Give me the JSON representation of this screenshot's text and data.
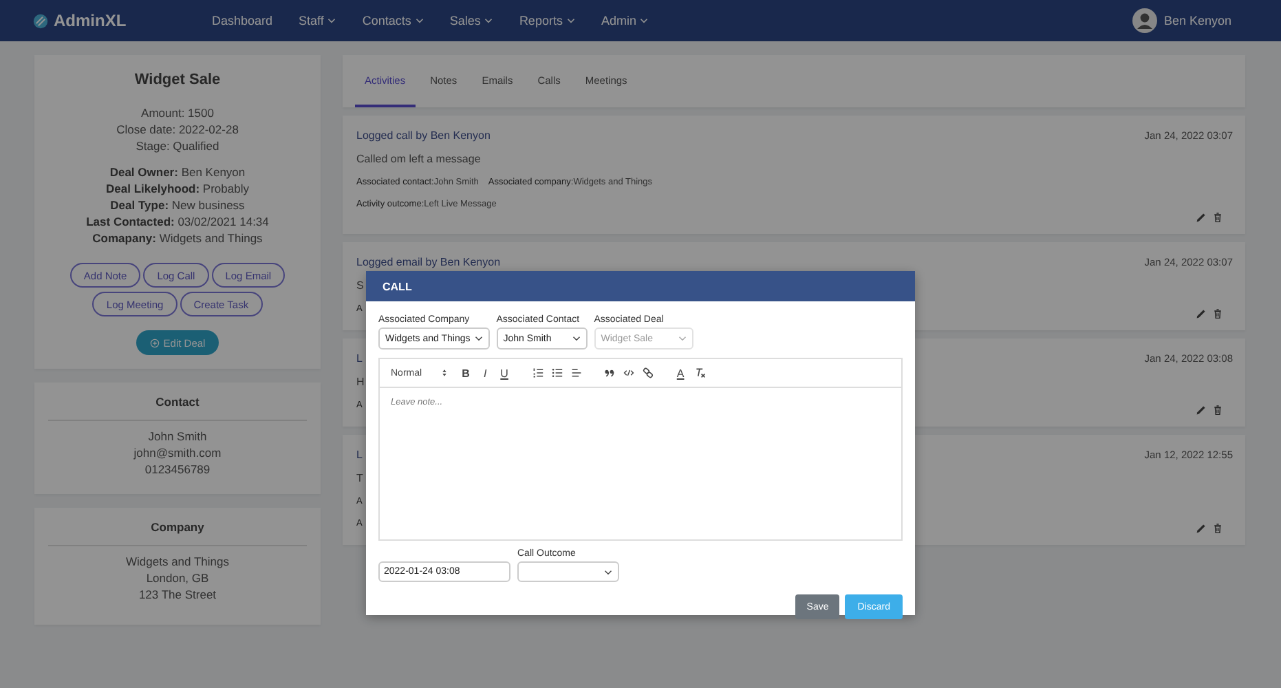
{
  "navbar": {
    "brand": "AdminXL",
    "menu": [
      {
        "label": "Dashboard",
        "dropdown": false
      },
      {
        "label": "Staff",
        "dropdown": true
      },
      {
        "label": "Contacts",
        "dropdown": true
      },
      {
        "label": "Sales",
        "dropdown": true
      },
      {
        "label": "Reports",
        "dropdown": true
      },
      {
        "label": "Admin",
        "dropdown": true
      }
    ],
    "user": "Ben Kenyon"
  },
  "deal": {
    "title": "Widget Sale",
    "summary": [
      "Amount: 1500",
      "Close date: 2022-02-28",
      "Stage: Qualified"
    ],
    "details": [
      {
        "label": "Deal Owner:",
        "value": "Ben Kenyon"
      },
      {
        "label": "Deal Likelyhood:",
        "value": "Probably"
      },
      {
        "label": "Deal Type:",
        "value": "New business"
      },
      {
        "label": "Last Contacted:",
        "value": "03/02/2021 14:34"
      },
      {
        "label": "Comapany:",
        "value": "Widgets and Things"
      }
    ],
    "actions": [
      "Add Note",
      "Log Call",
      "Log Email",
      "Log Meeting",
      "Create Task"
    ],
    "edit_button": "Edit Deal"
  },
  "contact": {
    "title": "Contact",
    "lines": [
      "John Smith",
      "john@smith.com",
      "0123456789"
    ]
  },
  "company": {
    "title": "Company",
    "lines": [
      "Widgets and Things",
      "London, GB",
      "123 The Street"
    ]
  },
  "tabs": [
    {
      "label": "Activities",
      "selected": true
    },
    {
      "label": "Notes",
      "selected": false
    },
    {
      "label": "Emails",
      "selected": false
    },
    {
      "label": "Calls",
      "selected": false
    },
    {
      "label": "Meetings",
      "selected": false
    }
  ],
  "activities": [
    {
      "title": "Logged call by Ben Kenyon",
      "date": "Jan 24, 2022 03:07",
      "lines": [
        {
          "kind": "body",
          "text": "Called om left a message"
        },
        {
          "kind": "meta",
          "items": [
            {
              "label": "Associated contact:",
              "value": "John Smith"
            },
            {
              "label": "Associated company:",
              "value": "Widgets and Things"
            }
          ]
        },
        {
          "kind": "meta",
          "items": [
            {
              "label": "Activity outcome:",
              "value": "Left Live Message"
            }
          ]
        }
      ]
    },
    {
      "title": "Logged email by Ben Kenyon",
      "date": "Jan 24, 2022 03:07",
      "lines": [
        {
          "kind": "body",
          "text": "S"
        },
        {
          "kind": "meta",
          "items": [
            {
              "label": "A",
              "value": ""
            }
          ]
        }
      ]
    },
    {
      "title": "L",
      "date": "Jan 24, 2022 03:08",
      "lines": [
        {
          "kind": "body",
          "text": "H"
        },
        {
          "kind": "meta",
          "items": [
            {
              "label": "A",
              "value": ""
            }
          ]
        }
      ]
    },
    {
      "title": "L",
      "date": "Jan 12, 2022 12:55",
      "lines": [
        {
          "kind": "body",
          "text": "T"
        },
        {
          "kind": "meta",
          "items": [
            {
              "label": "A",
              "value": ""
            }
          ]
        },
        {
          "kind": "meta",
          "items": [
            {
              "label": "A",
              "value": ""
            }
          ]
        }
      ]
    }
  ],
  "modal": {
    "title": "CALL",
    "fields": [
      {
        "label": "Associated Company",
        "value": "Widgets and Things",
        "disabled": false
      },
      {
        "label": "Associated Contact",
        "value": "John Smith",
        "disabled": false
      },
      {
        "label": "Associated Deal",
        "value": "Widget Sale",
        "disabled": true
      }
    ],
    "toolbar": {
      "format": "Normal",
      "buttons": [
        {
          "kind": "bold",
          "label": "B"
        },
        {
          "kind": "italic",
          "label": "I"
        },
        {
          "kind": "underline",
          "label": "U"
        },
        {
          "kind": "ordered-list"
        },
        {
          "kind": "bullet-list"
        },
        {
          "kind": "align"
        },
        {
          "kind": "quote"
        },
        {
          "kind": "code"
        },
        {
          "kind": "link"
        },
        {
          "kind": "color",
          "label": "A"
        },
        {
          "kind": "clean"
        }
      ]
    },
    "note_placeholder": "Leave note...",
    "date_value": "2022-01-24 03:08",
    "outcome_label": "Call Outcome",
    "buttons": [
      {
        "kind": "secondary",
        "label": "Save"
      },
      {
        "kind": "primary",
        "label": "Discard"
      }
    ]
  }
}
